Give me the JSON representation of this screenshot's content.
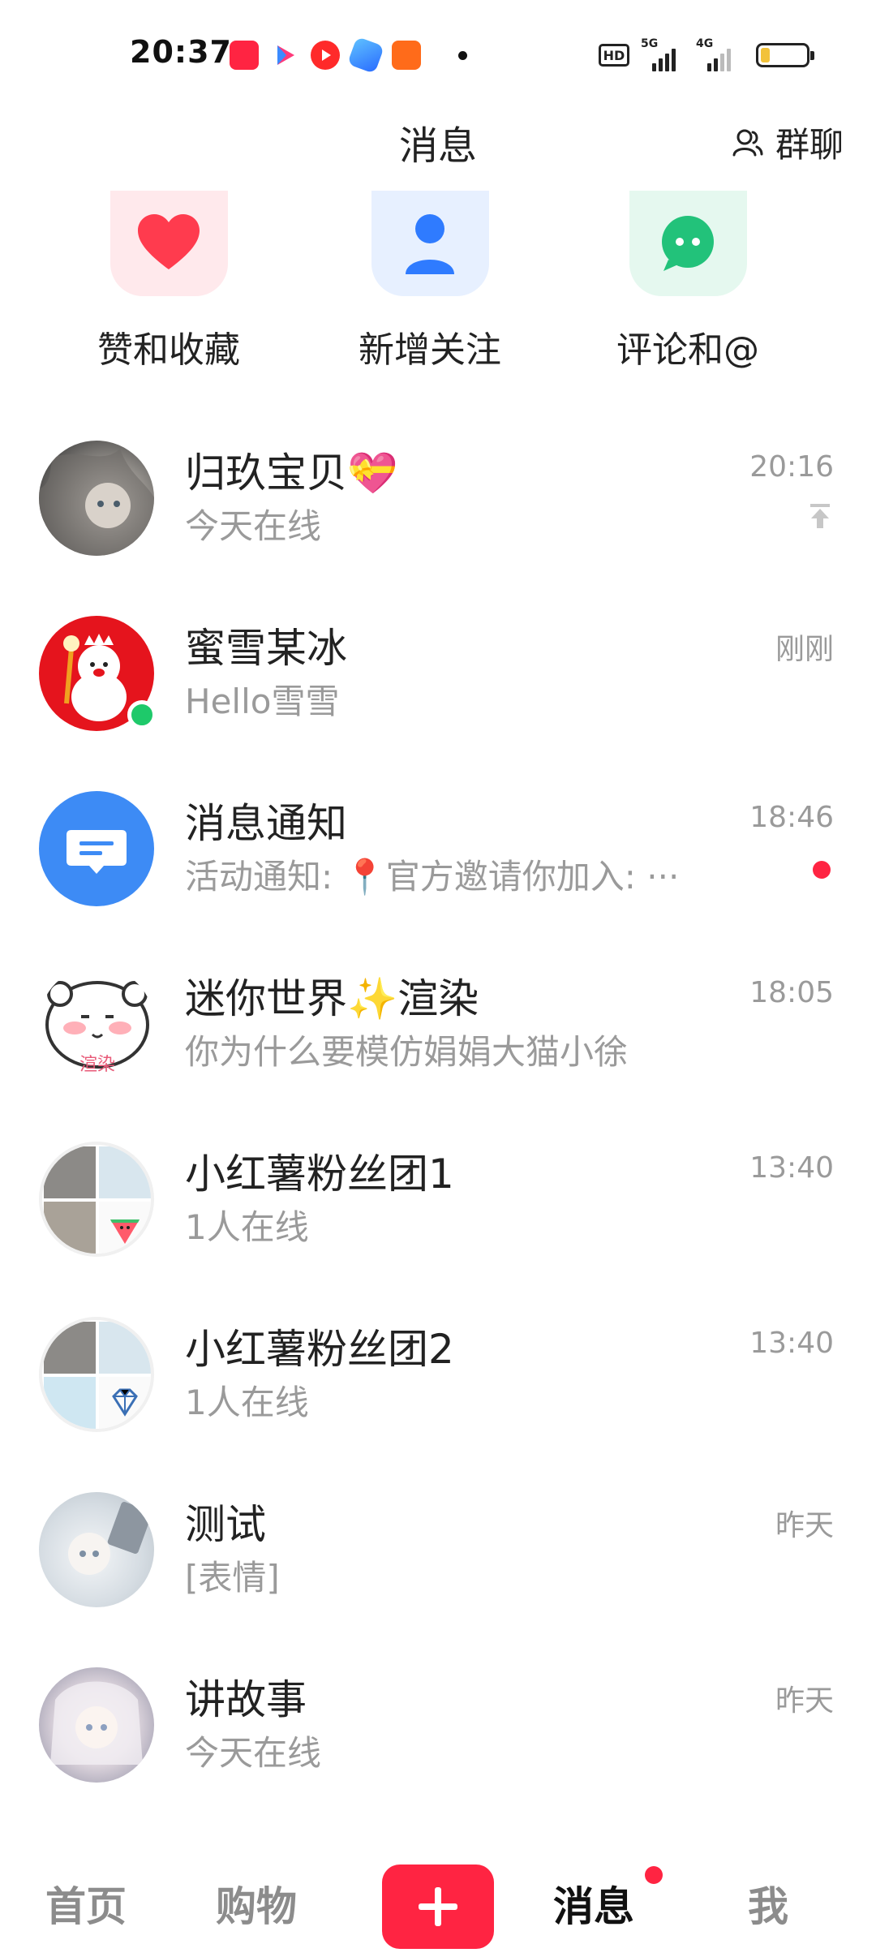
{
  "status_bar": {
    "time": "20:37",
    "hd_label": "HD",
    "net1": "5G",
    "net2": "4G"
  },
  "header": {
    "title": "消息",
    "group_chat_label": "群聊"
  },
  "quick_entries": [
    {
      "label": "赞和收藏",
      "icon": "heart-icon",
      "color": "#ff3b4e",
      "bg": "#ffe9ec"
    },
    {
      "label": "新增关注",
      "icon": "person-icon",
      "color": "#2f7bff",
      "bg": "#e7f0ff"
    },
    {
      "label": "评论和@",
      "icon": "chat-bubble-icon",
      "color": "#22c27a",
      "bg": "#e5f8ef"
    }
  ],
  "conversations": [
    {
      "name": "归玖宝贝💝",
      "preview": "今天在线",
      "time": "20:16",
      "pinned": true
    },
    {
      "name": "蜜雪某冰",
      "preview": "Hello雪雪",
      "time": "刚刚",
      "online": true
    },
    {
      "name": "消息通知",
      "preview": "活动通知: 📍官方邀请你加入: ···",
      "time": "18:46",
      "unread": true
    },
    {
      "name": "迷你世界✨渲染",
      "preview": "你为什么要模仿娟娟大猫小徐",
      "time": "18:05",
      "avatar_text": "渲染"
    },
    {
      "name": "小红薯粉丝团1",
      "preview": "1人在线",
      "time": "13:40"
    },
    {
      "name": "小红薯粉丝团2",
      "preview": "1人在线",
      "time": "13:40"
    },
    {
      "name": "测试",
      "preview": "[表情]",
      "time": "昨天"
    },
    {
      "name": "讲故事",
      "preview": "今天在线",
      "time": "昨天"
    }
  ],
  "bottom_nav": {
    "home": "首页",
    "shop": "购物",
    "messages": "消息",
    "me": "我"
  },
  "colors": {
    "accent": "#ff2442",
    "online": "#1ec96a",
    "notify_blue": "#3d8bf5"
  }
}
